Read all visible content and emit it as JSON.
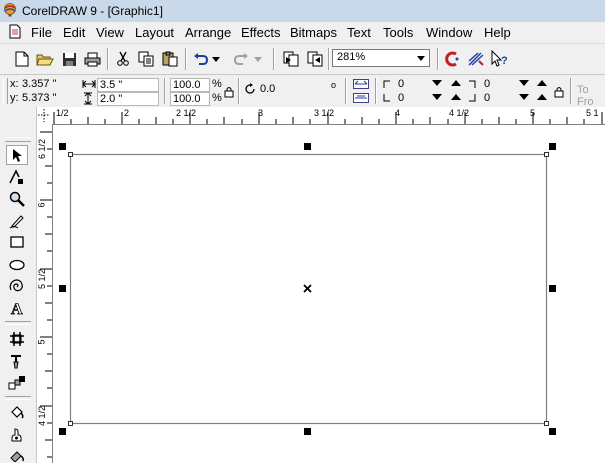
{
  "window": {
    "title": "CorelDRAW 9 - [Graphic1]"
  },
  "menu": {
    "items": [
      "File",
      "Edit",
      "View",
      "Layout",
      "Arrange",
      "Effects",
      "Bitmaps",
      "Text",
      "Tools",
      "Window",
      "Help"
    ]
  },
  "standard_toolbar": {
    "buttons": [
      "new-document",
      "open",
      "save",
      "print",
      "cut",
      "copy",
      "paste",
      "undo",
      "undo-dropdown",
      "redo",
      "redo-dropdown",
      "import",
      "export"
    ],
    "zoom_value": "281%",
    "right_buttons": [
      "corel-tutor",
      "launch-app",
      "whats-this"
    ]
  },
  "property_bar": {
    "x_label": "x:",
    "x_value": "3.357 \"",
    "y_label": "y:",
    "y_value": "5.373 \"",
    "width_value": "3.5 \"",
    "height_value": "2.0 \"",
    "scale_x": "100.0",
    "scale_y": "100.0",
    "pct_symbol": "%",
    "rotation_value": "0.0",
    "degree_symbol": "o",
    "corner1": "0",
    "corner2": "0",
    "corner3": "0",
    "corner4": "0",
    "to_front_label": "To Fro"
  },
  "rulers": {
    "horizontal_labels": [
      "1/2",
      "2",
      "2 1/2",
      "3",
      "3 1/2",
      "4",
      "4 1/2",
      "5",
      "5 1"
    ],
    "vertical_labels": [
      "6 1/2",
      "6",
      "5 1/2",
      "5",
      "4 1/2"
    ]
  },
  "toolbox": {
    "tools": [
      "pick-tool",
      "shape-tool",
      "zoom-tool",
      "freehand-tool",
      "rectangle-tool",
      "ellipse-tool",
      "polygon-tool",
      "text-tool",
      "interactive-blend-tool",
      "eyedropper-tool",
      "outline-tool",
      "fill-tool",
      "interactive-fill-tool"
    ]
  }
}
